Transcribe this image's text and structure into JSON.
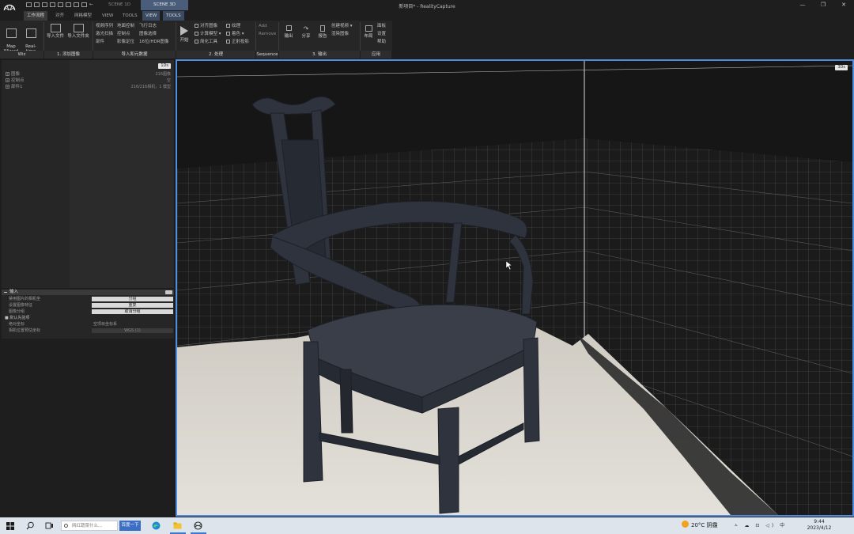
{
  "window": {
    "title": "新项目* - RealityCapture",
    "tabs": [
      "SCENE 1D",
      "SCENE 3D"
    ],
    "controls": [
      "—",
      "❐",
      "✕"
    ]
  },
  "menu": {
    "tabs": [
      "工作流程",
      "对齐",
      "网格模型",
      "VIEW",
      "TOOLS",
      "VIEW",
      "TOOLS"
    ]
  },
  "ribbon": {
    "wiz": {
      "map_wizard": "Map\nWizard",
      "realtime_assistance": "Real-time\nAssistance",
      "label": "Wiz"
    },
    "add_images": {
      "import_file": "导入文件",
      "import_folder": "导入文件夹",
      "label": "1. 添加图像"
    },
    "import_data": {
      "items": [
        "视频序列",
        "激光扫描",
        "部件",
        "地面控制",
        "控制点",
        "影像定位",
        "飞行日志",
        "图像选择",
        "16位/HDR图像"
      ],
      "label": "导入和元数据"
    },
    "process": {
      "start": "开始",
      "items": [
        "对齐图像",
        "计算模型",
        "简化工具",
        "纹理",
        "着色",
        "正射投影"
      ],
      "label": "2. 处理"
    },
    "sequence": {
      "items": [
        "Add",
        "Remove"
      ],
      "label": "Sequence"
    },
    "output": {
      "export": "输出",
      "share": "分享",
      "report": "报告",
      "items": [
        "创建视频",
        "渲染图像"
      ],
      "label": "3. 输出"
    },
    "app": {
      "layout": "布局",
      "items": [
        "面板",
        "设置",
        "帮助"
      ],
      "label": "应用"
    }
  },
  "tree_panel": {
    "badge": "1Ds",
    "rows": [
      {
        "label": "图像",
        "value": "216图像"
      },
      {
        "label": "控制点",
        "value": "空"
      },
      {
        "label": "部件1",
        "value": "216/216相机，1 模型"
      }
    ]
  },
  "input_panel": {
    "title": "输入",
    "rows": [
      {
        "key": "禁用图片的相机坐",
        "value": "分组"
      },
      {
        "key": "设置图像特征",
        "value": "重复"
      },
      {
        "key": "图像分组",
        "value": "取消分组"
      }
    ],
    "section": "默认先验项",
    "section_rows": [
      {
        "key": "绝对坐标",
        "value": "空项目坐标系"
      },
      {
        "key": "相机位置预估坐标",
        "value": "WGS (1)"
      }
    ]
  },
  "viewport": {
    "badge": "3Ds"
  },
  "taskbar": {
    "search_placeholder": "网红蔬菜什么...",
    "search_button": "百度一下",
    "weather": "20°C 阴霾",
    "tray": "ㅅ ☁ ⊡ ◁) 中",
    "time": "9:44",
    "date": "2023/4/12"
  }
}
